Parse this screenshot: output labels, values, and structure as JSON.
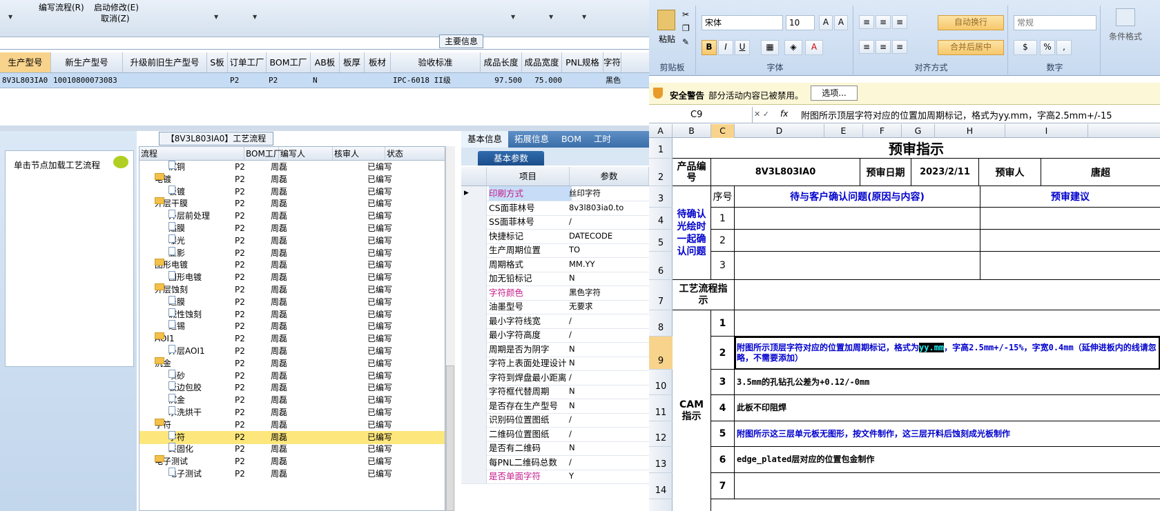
{
  "menu": {
    "row1": [
      "编写流程(R)",
      "启动修改(E)"
    ],
    "row2": [
      "取消(Z)"
    ]
  },
  "main_info_label": "主要信息",
  "grid": {
    "columns": [
      "生产型号",
      "新生产型号",
      "升级前旧生产型号",
      "S板",
      "订单工厂",
      "BOM工厂",
      "AB板",
      "板厚",
      "板材",
      "验收标准",
      "成品长度",
      "成品宽度",
      "PNL规格",
      "字符"
    ],
    "row": [
      "8V3L803IA0",
      "10010800073083",
      "",
      "",
      "P2",
      "P2",
      "N",
      "",
      "",
      "IPC-6018 II级",
      "97.500",
      "75.000",
      "",
      "黑色字符"
    ]
  },
  "workflow_panel": {
    "title": "单击节点加载工艺流程"
  },
  "tree": {
    "title": "【8V3L803IA0】工艺流程",
    "columns": [
      "流程",
      "BOM工厂",
      "编写人",
      "核审人",
      "状态"
    ],
    "rows": [
      {
        "level": 1,
        "type": "doc",
        "name": "沉铜",
        "bom": "P2",
        "writer": "周磊",
        "reviewer": "",
        "status": "已编写"
      },
      {
        "level": 0,
        "type": "folder",
        "name": "电镀",
        "bom": "P2",
        "writer": "周磊",
        "reviewer": "",
        "status": "已编写"
      },
      {
        "level": 1,
        "type": "doc",
        "name": "板镀",
        "bom": "P2",
        "writer": "周磊",
        "reviewer": "",
        "status": "已编写"
      },
      {
        "level": 0,
        "type": "folder",
        "name": "外层干膜",
        "bom": "P2",
        "writer": "周磊",
        "reviewer": "",
        "status": "已编写"
      },
      {
        "level": 1,
        "type": "doc",
        "name": "外层前处理",
        "bom": "P2",
        "writer": "周磊",
        "reviewer": "",
        "status": "已编写"
      },
      {
        "level": 1,
        "type": "doc",
        "name": "贴膜",
        "bom": "P2",
        "writer": "周磊",
        "reviewer": "",
        "status": "已编写"
      },
      {
        "level": 1,
        "type": "doc",
        "name": "曝光",
        "bom": "P2",
        "writer": "周磊",
        "reviewer": "",
        "status": "已编写"
      },
      {
        "level": 1,
        "type": "doc",
        "name": "显影",
        "bom": "P2",
        "writer": "周磊",
        "reviewer": "",
        "status": "已编写"
      },
      {
        "level": 0,
        "type": "folder",
        "name": "图形电镀",
        "bom": "P2",
        "writer": "周磊",
        "reviewer": "",
        "status": "已编写"
      },
      {
        "level": 1,
        "type": "doc",
        "name": "图形电镀",
        "bom": "P2",
        "writer": "周磊",
        "reviewer": "",
        "status": "已编写"
      },
      {
        "level": 0,
        "type": "folder",
        "name": "外层蚀刻",
        "bom": "P2",
        "writer": "周磊",
        "reviewer": "",
        "status": "已编写"
      },
      {
        "level": 1,
        "type": "doc",
        "name": "退膜",
        "bom": "P2",
        "writer": "周磊",
        "reviewer": "",
        "status": "已编写"
      },
      {
        "level": 1,
        "type": "doc",
        "name": "碱性蚀刻",
        "bom": "P2",
        "writer": "周磊",
        "reviewer": "",
        "status": "已编写"
      },
      {
        "level": 1,
        "type": "doc",
        "name": "退锡",
        "bom": "P2",
        "writer": "周磊",
        "reviewer": "",
        "status": "已编写"
      },
      {
        "level": 0,
        "type": "folder",
        "name": "AOI1",
        "bom": "P2",
        "writer": "周磊",
        "reviewer": "",
        "status": "已编写"
      },
      {
        "level": 1,
        "type": "doc",
        "name": "外层AOI1",
        "bom": "P2",
        "writer": "周磊",
        "reviewer": "",
        "status": "已编写"
      },
      {
        "level": 0,
        "type": "folder",
        "name": "沉金",
        "bom": "P2",
        "writer": "周磊",
        "reviewer": "",
        "status": "已编写"
      },
      {
        "level": 1,
        "type": "doc",
        "name": "喷砂",
        "bom": "P2",
        "writer": "周磊",
        "reviewer": "",
        "status": "已编写"
      },
      {
        "level": 1,
        "type": "doc",
        "name": "板边包胶",
        "bom": "P2",
        "writer": "周磊",
        "reviewer": "",
        "status": "已编写"
      },
      {
        "level": 1,
        "type": "doc",
        "name": "沉金",
        "bom": "P2",
        "writer": "周磊",
        "reviewer": "",
        "status": "已编写"
      },
      {
        "level": 1,
        "type": "doc",
        "name": "水洗烘干",
        "bom": "P2",
        "writer": "周磊",
        "reviewer": "",
        "status": "已编写"
      },
      {
        "level": 0,
        "type": "folder",
        "name": "字符",
        "bom": "P2",
        "writer": "周磊",
        "reviewer": "",
        "status": "已编写"
      },
      {
        "level": 1,
        "type": "doc",
        "name": "字符",
        "bom": "P2",
        "writer": "周磊",
        "reviewer": "",
        "status": "已编写",
        "selected": true
      },
      {
        "level": 1,
        "type": "doc",
        "name": "终固化",
        "bom": "P2",
        "writer": "周磊",
        "reviewer": "",
        "status": "已编写"
      },
      {
        "level": 0,
        "type": "folder",
        "name": "电子测试",
        "bom": "P2",
        "writer": "周磊",
        "reviewer": "",
        "status": "已编写"
      },
      {
        "level": 1,
        "type": "doc",
        "name": "电子测试",
        "bom": "P2",
        "writer": "周磊",
        "reviewer": "",
        "status": "已编写"
      }
    ]
  },
  "props": {
    "tabs": [
      "基本信息",
      "拓展信息",
      "BOM",
      "工时"
    ],
    "subtab": "基本参数",
    "columns": [
      "项目",
      "参数"
    ],
    "rows": [
      {
        "k": "印刷方式",
        "v": "丝印字符",
        "pink": true,
        "sel": true
      },
      {
        "k": "CS面菲林号",
        "v": "8v3l803ia0.to"
      },
      {
        "k": "SS面菲林号",
        "v": "/"
      },
      {
        "k": "快捷标记",
        "v": "DATECODE"
      },
      {
        "k": "生产周期位置",
        "v": "TO"
      },
      {
        "k": "周期格式",
        "v": "MM.YY"
      },
      {
        "k": "加无铅标记",
        "v": "N"
      },
      {
        "k": "字符颜色",
        "v": "黑色字符",
        "pink": true
      },
      {
        "k": "油墨型号",
        "v": "无要求"
      },
      {
        "k": "最小字符线宽",
        "v": "/"
      },
      {
        "k": "最小字符高度",
        "v": "/"
      },
      {
        "k": "周期是否为阴字",
        "v": "N"
      },
      {
        "k": "字符上表面处理设计",
        "v": "N"
      },
      {
        "k": "字符到焊盘最小距离",
        "v": "/"
      },
      {
        "k": "字符框代替周期",
        "v": "N"
      },
      {
        "k": "是否存在生产型号",
        "v": "N"
      },
      {
        "k": "识别码位置图纸",
        "v": "/"
      },
      {
        "k": "二维码位置图纸",
        "v": "/"
      },
      {
        "k": "是否有二维码",
        "v": "N"
      },
      {
        "k": "每PNL二维码总数",
        "v": "/"
      },
      {
        "k": "是否单面字符",
        "v": "Y",
        "pink": true
      }
    ]
  },
  "excel": {
    "ribbon": {
      "paste": "粘贴",
      "font_name": "宋体",
      "font_size": "10",
      "wrap": "自动换行",
      "merge": "合并后居中",
      "number_format": "常规",
      "cond_format": "条件格式",
      "groups": [
        "剪贴板",
        "字体",
        "对齐方式",
        "数字"
      ],
      "format_buttons": [
        "B",
        "I",
        "U"
      ]
    },
    "security": {
      "label": "安全警告",
      "text": "部分活动内容已被禁用。",
      "button": "选项..."
    },
    "namebox": "C9",
    "fx": "fx",
    "formula": "附图所示顶层字符对应的位置加周期标记，格式为yy.mm，字高2.5mm+/-15",
    "col_headers": [
      "A",
      "B",
      "C",
      "D",
      "E",
      "F",
      "G",
      "H",
      "I"
    ],
    "row_headers": [
      "1",
      "2",
      "3",
      "4",
      "5",
      "6",
      "7",
      "8",
      "9",
      "10",
      "11",
      "12",
      "13",
      "14"
    ],
    "title": "预审指示",
    "product_label": "产品编号",
    "product_no": "8V3L803IA0",
    "date_label": "预审日期",
    "date": "2023/2/11",
    "reviewer_label": "预审人",
    "reviewer": "唐超",
    "seq_label": "序号",
    "confirm_header": "待与客户确认问题(原因与内容)",
    "suggest_header": "预审建议",
    "confirm_side": "待确认光绘时一起确认问题",
    "process_label": "工艺流程指示",
    "cam_label": "CAM指示",
    "seq": [
      "1",
      "2",
      "3"
    ],
    "cam_rows": [
      {
        "n": "1",
        "text": ""
      },
      {
        "n": "2",
        "pre": "附图所示顶层字符对应的位置加周期标记，格式为",
        "hl": "yy.mm",
        "post": "，字高2.5mm+/-15%，字宽0.4mm（延伸进板内的线请忽略，不需要添加）",
        "blue": true
      },
      {
        "n": "3",
        "text": "3.5mm的孔钻孔公差为+0.12/-0mm"
      },
      {
        "n": "4",
        "text": "此板不印阻焊"
      },
      {
        "n": "5",
        "text": "附图所示这三层单元板无图形，按文件制作，这三层开料后蚀刻成光板制作",
        "blue": true
      },
      {
        "n": "6",
        "text": "edge_plated层对应的位置包金制作"
      },
      {
        "n": "7",
        "text": ""
      }
    ]
  }
}
